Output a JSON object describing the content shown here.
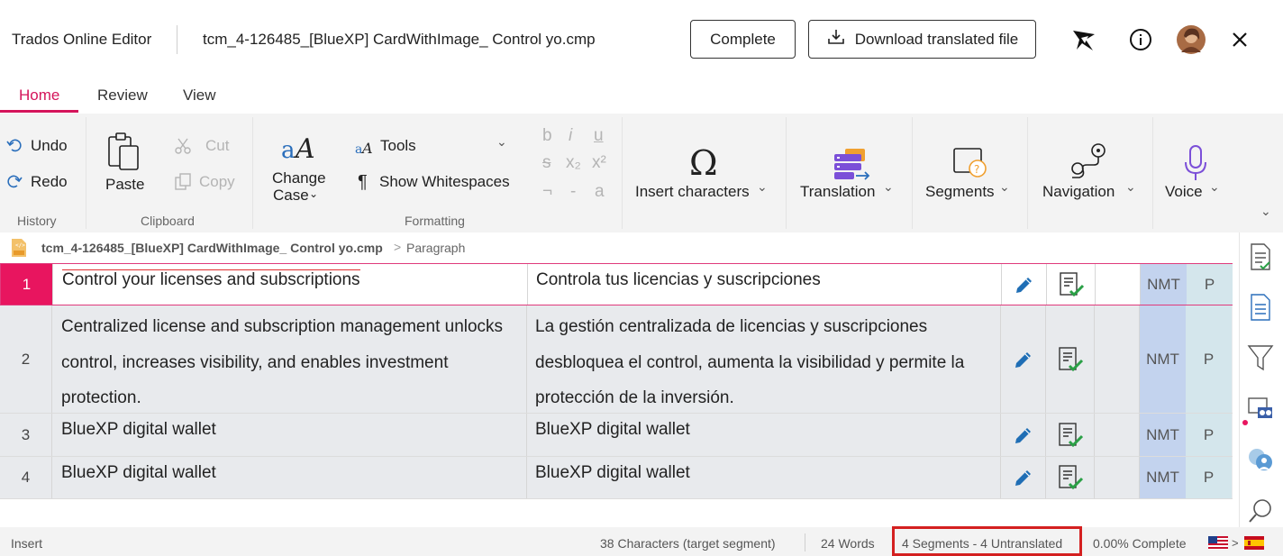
{
  "app": {
    "title": "Trados Online Editor",
    "document_title": "tcm_4-126485_[BlueXP] CardWithImage_ Control yo.cmp",
    "complete_label": "Complete",
    "download_label": "Download translated file"
  },
  "tabs": [
    "Home",
    "Review",
    "View"
  ],
  "ribbon": {
    "undo": "Undo",
    "redo": "Redo",
    "paste": "Paste",
    "cut": "Cut",
    "copy": "Copy",
    "change_case_line1": "Change",
    "change_case_line2": "Case",
    "tools": "Tools",
    "show_whitespaces": "Show Whitespaces",
    "format_glyphs": [
      "b",
      "i",
      "u",
      "s",
      "x₂",
      "x²",
      "¬",
      "-",
      "a"
    ],
    "insert_characters": "Insert characters",
    "translation": "Translation",
    "segments": "Segments",
    "navigation": "Navigation",
    "voice": "Voice",
    "groups": {
      "history": "History",
      "clipboard": "Clipboard",
      "formatting": "Formatting"
    }
  },
  "breadcrumb": {
    "file": "tcm_4-126485_[BlueXP] CardWithImage_ Control yo.cmp",
    "separator": ">",
    "item": "Paragraph"
  },
  "segments": [
    {
      "number": "1",
      "source": "Control your licenses and subscriptions",
      "target": "Controla tus licencias y suscripciones",
      "origin": "NMT",
      "status": "P"
    },
    {
      "number": "2",
      "source": "Centralized license and subscription management unlocks control, increases visibility, and enables investment protection.",
      "target": "La gestión centralizada de licencias y suscripciones desbloquea el control, aumenta la visibilidad y permite la protección de la inversión.",
      "origin": "NMT",
      "status": "P"
    },
    {
      "number": "3",
      "source": "BlueXP digital wallet",
      "target": "BlueXP digital wallet",
      "origin": "NMT",
      "status": "P"
    },
    {
      "number": "4",
      "source": "BlueXP digital wallet",
      "target": "BlueXP digital wallet",
      "origin": "NMT",
      "status": "P"
    }
  ],
  "status_bar": {
    "mode": "Insert",
    "characters": "38 Characters (target segment)",
    "words": "24 Words",
    "segments": "4 Segments - 4 Untranslated",
    "complete": "0.00% Complete",
    "lang_separator": ">"
  },
  "colors": {
    "accent": "#d4145a",
    "active_row_number": "#e8155f",
    "highlight_box": "#d42020",
    "origin_cell": "#c3d3ee",
    "status_cell": "#d4e6ec"
  },
  "icons": [
    "trados-logo-icon",
    "info-icon",
    "avatar",
    "close-icon",
    "download-icon",
    "undo-icon",
    "redo-icon",
    "paste-icon",
    "cut-icon",
    "copy-icon",
    "change-case-icon",
    "tools-icon",
    "pilcrow-icon",
    "omega-icon",
    "translation-icon",
    "segments-icon",
    "navigation-icon",
    "microphone-icon",
    "pencil-icon",
    "confirmed-status-icon",
    "us-flag-icon",
    "es-flag-icon"
  ]
}
